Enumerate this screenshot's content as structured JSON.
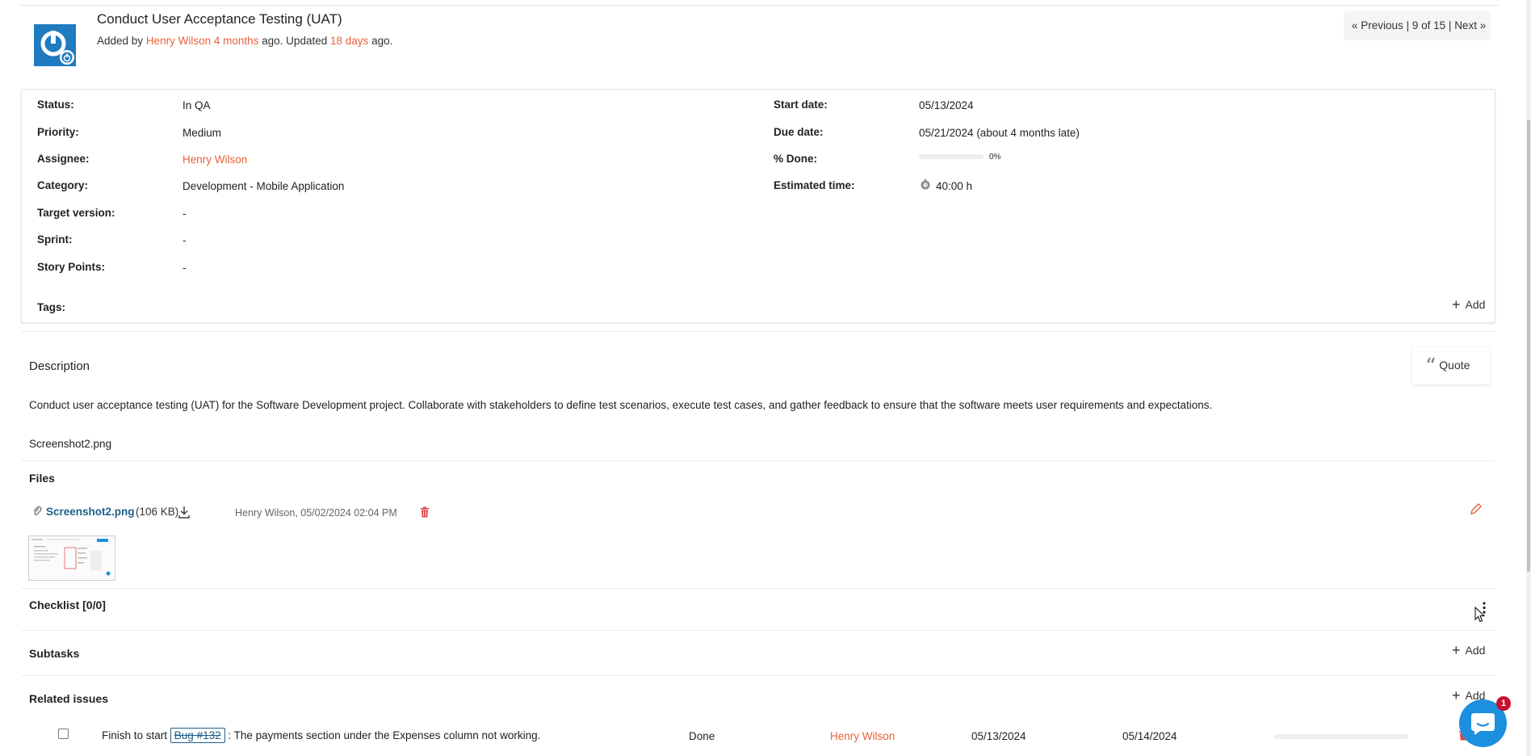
{
  "issue": {
    "title": "Conduct User Acceptance Testing (UAT)",
    "added_by_prefix": "Added by",
    "author": "Henry Wilson",
    "created_ago": "4 months",
    "ago_updated": "ago. Updated",
    "updated_ago": "18 days",
    "ago_end": "ago."
  },
  "pager": {
    "previous": "« Previous",
    "sep": "|",
    "position": "9 of 15",
    "next": "Next »"
  },
  "attributes": {
    "left": [
      {
        "label": "Status:",
        "value": "In QA",
        "link": false
      },
      {
        "label": "Priority:",
        "value": "Medium",
        "link": false
      },
      {
        "label": "Assignee:",
        "value": "Henry Wilson",
        "link": true
      },
      {
        "label": "Category:",
        "value": "Development - Mobile Application",
        "link": false
      },
      {
        "label": "Target version:",
        "value": "-",
        "link": false
      },
      {
        "label": "Sprint:",
        "value": "-",
        "link": false
      },
      {
        "label": "Story Points:",
        "value": "-",
        "link": false
      }
    ],
    "right": {
      "start_label": "Start date:",
      "start_value": "05/13/2024",
      "due_label": "Due date:",
      "due_value": "05/21/2024 (about 4 months late)",
      "done_label": "% Done:",
      "done_value": "0%",
      "done_fraction": 0,
      "est_label": "Estimated time:",
      "est_value": "40:00 h"
    },
    "tags_label": "Tags:",
    "tags_add": "Add"
  },
  "description": {
    "heading": "Description",
    "quote_label": "Quote",
    "text": "Conduct user acceptance testing (UAT) for the Software Development project. Collaborate with stakeholders to define test scenarios, execute test cases, and gather feedback to ensure that the software meets user requirements and expectations.",
    "attachment_ref": "Screenshot2.png"
  },
  "files": {
    "heading": "Files",
    "filename": "Screenshot2.png",
    "size": "(106 KB)",
    "meta": "Henry Wilson, 05/02/2024 02:04 PM"
  },
  "checklist": {
    "heading": "Checklist [0/0]"
  },
  "subtasks": {
    "heading": "Subtasks",
    "add": "Add"
  },
  "related": {
    "heading": "Related issues",
    "add": "Add",
    "rows": [
      {
        "prefix": "Finish to start",
        "ref": "Bug #132",
        "summary": ": The payments section under the Expenses column not working.",
        "status": "Done",
        "assignee": "Henry Wilson",
        "start": "05/13/2024",
        "due": "05/14/2024"
      }
    ]
  },
  "chat": {
    "badge": "1"
  },
  "colors": {
    "accent": "#e8623a",
    "link_blue": "#1f5f8b",
    "avatar_blue": "#1e7bc0",
    "chat_blue": "#1c8fde",
    "badge_red": "#c8102e",
    "delete_red": "#e04545"
  }
}
